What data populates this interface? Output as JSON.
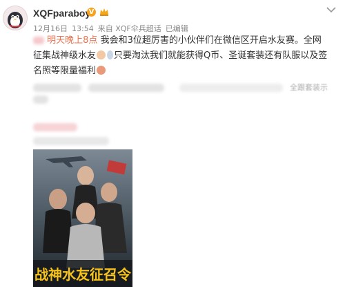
{
  "post": {
    "author": "XQFparaboy",
    "verified_badge": "V",
    "date": "12月16日",
    "time": "13:54",
    "source": "来自 XQF伞兵超话",
    "edited": "已编辑",
    "time_highlight": "明天晚上8点",
    "text_part1": "我会和3位超厉害的小伙伴们在微信区开启水友赛。全网征集战神级水友",
    "text_part2": "只要淘汰我们就能获得Q币、圣诞套装还有队服以及签名照等限量福利",
    "partial_blurred_text": "全跟套装示",
    "poster_title": "战神水友征召令"
  },
  "colors": {
    "highlight": "#eb7350",
    "badge": "#f7a21b",
    "poster_title": "#f7c21a"
  },
  "icons": [
    "avatar-penguin",
    "verified-icon",
    "crown-icon",
    "chevron-down-icon",
    "emoji-icon"
  ]
}
